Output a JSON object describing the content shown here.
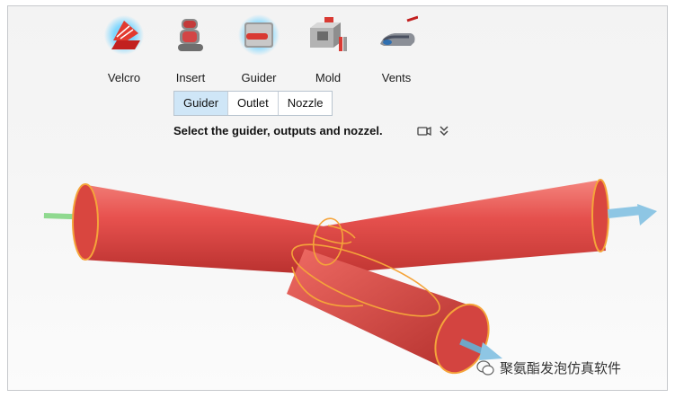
{
  "toolbar": {
    "tools": [
      {
        "label": "Velcro",
        "icon": "velcro-icon"
      },
      {
        "label": "Insert",
        "icon": "seat-icon"
      },
      {
        "label": "Guider",
        "icon": "guider-icon"
      },
      {
        "label": "Mold",
        "icon": "mold-icon"
      },
      {
        "label": "Vents",
        "icon": "vents-icon"
      }
    ]
  },
  "tabs": [
    {
      "label": "Guider",
      "active": true
    },
    {
      "label": "Outlet",
      "active": false
    },
    {
      "label": "Nozzle",
      "active": false
    }
  ],
  "prompt": {
    "text": "Select the guider, outputs and nozzel.",
    "icons": [
      "camera-icon",
      "double-chevron-down-icon"
    ]
  },
  "viewport": {
    "pipe_color": "#e8524f",
    "edge_color": "#f5a43a",
    "arrow_color": "#8ec6e4",
    "input_arrow_color": "#8fd98f"
  },
  "watermark": {
    "text": "聚氨酯发泡仿真软件",
    "icon": "wechat-icon"
  }
}
